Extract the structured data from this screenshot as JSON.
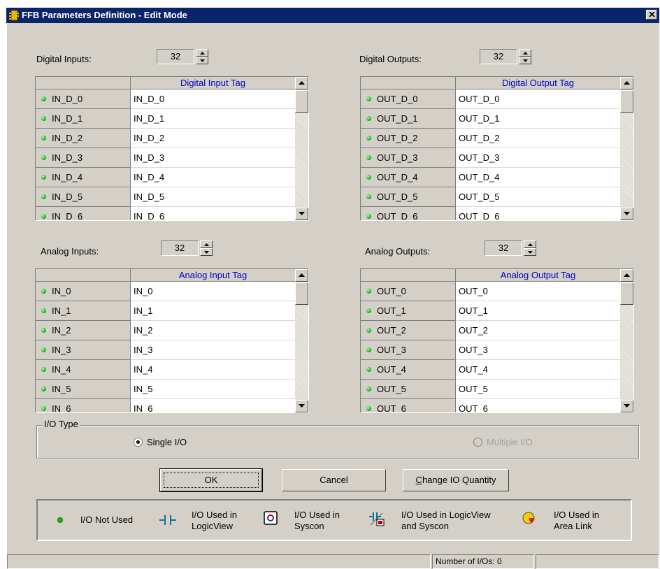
{
  "window": {
    "title": "FFB Parameters Definition - Edit Mode"
  },
  "digital_inputs": {
    "label": "Digital Inputs:",
    "count": "32",
    "column": "Digital Input Tag",
    "rows": [
      {
        "name": "IN_D_0",
        "tag": "IN_D_0"
      },
      {
        "name": "IN_D_1",
        "tag": "IN_D_1"
      },
      {
        "name": "IN_D_2",
        "tag": "IN_D_2"
      },
      {
        "name": "IN_D_3",
        "tag": "IN_D_3"
      },
      {
        "name": "IN_D_4",
        "tag": "IN_D_4"
      },
      {
        "name": "IN_D_5",
        "tag": "IN_D_5"
      },
      {
        "name": "IN_D_6",
        "tag": "IN_D_6"
      }
    ]
  },
  "digital_outputs": {
    "label": "Digital Outputs:",
    "count": "32",
    "column": "Digital Output Tag",
    "rows": [
      {
        "name": "OUT_D_0",
        "tag": "OUT_D_0"
      },
      {
        "name": "OUT_D_1",
        "tag": "OUT_D_1"
      },
      {
        "name": "OUT_D_2",
        "tag": "OUT_D_2"
      },
      {
        "name": "OUT_D_3",
        "tag": "OUT_D_3"
      },
      {
        "name": "OUT_D_4",
        "tag": "OUT_D_4"
      },
      {
        "name": "OUT_D_5",
        "tag": "OUT_D_5"
      },
      {
        "name": "OUT_D_6",
        "tag": "OUT_D_6"
      }
    ]
  },
  "analog_inputs": {
    "label": "Analog Inputs:",
    "count": "32",
    "column": "Analog Input Tag",
    "rows": [
      {
        "name": "IN_0",
        "tag": "IN_0"
      },
      {
        "name": "IN_1",
        "tag": "IN_1"
      },
      {
        "name": "IN_2",
        "tag": "IN_2"
      },
      {
        "name": "IN_3",
        "tag": "IN_3"
      },
      {
        "name": "IN_4",
        "tag": "IN_4"
      },
      {
        "name": "IN_5",
        "tag": "IN_5"
      },
      {
        "name": "IN_6",
        "tag": "IN_6"
      }
    ]
  },
  "analog_outputs": {
    "label": "Analog Outputs:",
    "count": "32",
    "column": "Analog Output Tag",
    "rows": [
      {
        "name": "OUT_0",
        "tag": "OUT_0"
      },
      {
        "name": "OUT_1",
        "tag": "OUT_1"
      },
      {
        "name": "OUT_2",
        "tag": "OUT_2"
      },
      {
        "name": "OUT_3",
        "tag": "OUT_3"
      },
      {
        "name": "OUT_4",
        "tag": "OUT_4"
      },
      {
        "name": "OUT_5",
        "tag": "OUT_5"
      },
      {
        "name": "OUT_6",
        "tag": "OUT_6"
      }
    ]
  },
  "io_type": {
    "title": "I/O Type",
    "single": "Single I/O",
    "multiple": "Multiple I/O",
    "selected": "single"
  },
  "buttons": {
    "ok": "OK",
    "cancel": "Cancel",
    "change_pre": "",
    "change_underline": "C",
    "change_rest": "hange IO Quantity"
  },
  "legend": {
    "not_used": "I/O Not Used",
    "logicview_l1": "I/O Used in",
    "logicview_l2": "LogicView",
    "syscon_l1": "I/O Used in",
    "syscon_l2": "Syscon",
    "both_l1": "I/O Used in LogicView",
    "both_l2": "and Syscon",
    "area_l1": "I/O Used in",
    "area_l2": "Area Link"
  },
  "statusbar": {
    "io_count": "Number of I/Os: 0"
  },
  "colors": {
    "titlebar": "#0a246a",
    "face": "#d4d0c8",
    "header_text": "#0000c8",
    "unused_dot": "#18b418"
  }
}
